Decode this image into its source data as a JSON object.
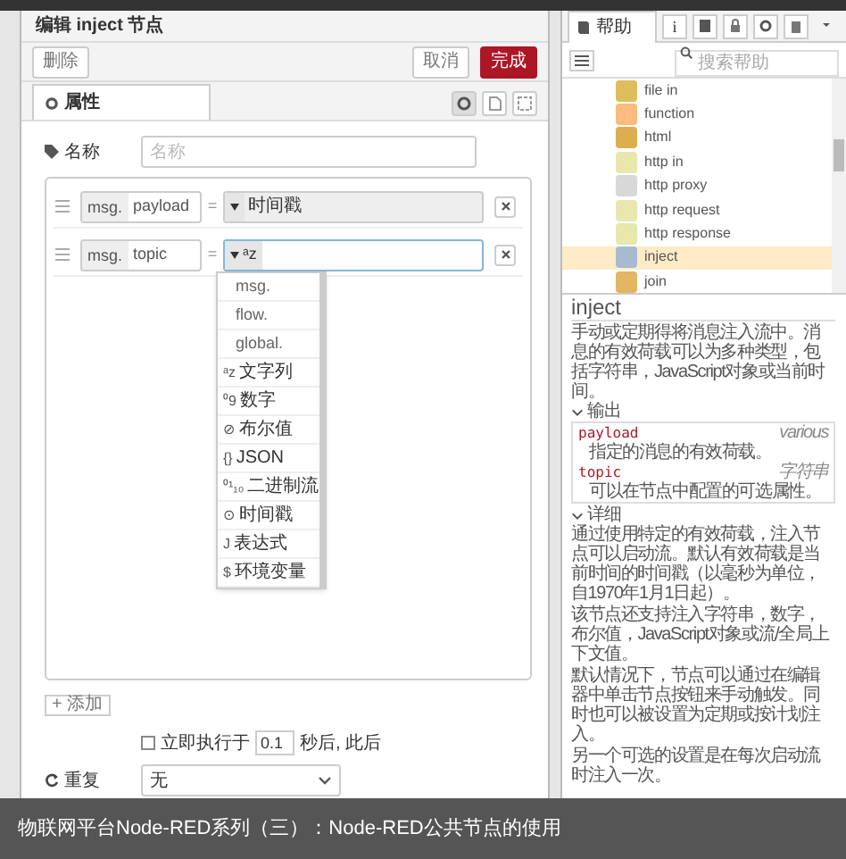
{
  "editor": {
    "title": "编辑 inject 节点",
    "buttons": [
      {
        "label": "删除",
        "kind": "plain"
      },
      {
        "label": "取消",
        "kind": "plain"
      },
      {
        "label": "完成",
        "kind": "primary"
      }
    ],
    "tab": {
      "label": "属性",
      "selected": true
    },
    "name_field": {
      "label": "名称",
      "placeholder": "名称"
    },
    "properties": [
      {
        "prefix": "msg.",
        "field": "payload",
        "equals": "=",
        "value_label": "时间戳",
        "focused": false
      },
      {
        "prefix": "msg.",
        "field": "topic",
        "equals": "=",
        "type_icon": "ᵃz",
        "focused": true
      }
    ],
    "type_menu": [
      {
        "label": "msg."
      },
      {
        "label": "flow."
      },
      {
        "label": "global."
      },
      {
        "icon": "ᵃz",
        "label": "文字列"
      },
      {
        "icon": "⁰9",
        "label": "数字"
      },
      {
        "icon": "⊘",
        "label": "布尔值"
      },
      {
        "icon": "{}",
        "label": "JSON"
      },
      {
        "icon": "⁰¹₁₀",
        "label": "二进制流"
      },
      {
        "icon": "⊙",
        "label": "时间戳"
      },
      {
        "icon": "J",
        "label": "表达式"
      },
      {
        "icon": "$",
        "label": "环境变量"
      }
    ],
    "add_button": "+ 添加",
    "once": {
      "checked": false,
      "label": "立即执行于",
      "value": "0.1",
      "suffix": "秒后, 此后"
    },
    "repeat": {
      "label": "重复",
      "value": "无"
    }
  },
  "sidebar": {
    "tab": {
      "label": "帮助",
      "selected": true
    },
    "tool_icons": [
      "i"
    ],
    "search": {
      "placeholder": "搜索帮助"
    },
    "nodes": [
      {
        "label": "file in",
        "color": "#debd5c",
        "selected": false
      },
      {
        "label": "function",
        "color": "#fdbb7d",
        "selected": false
      },
      {
        "label": "html",
        "color": "#dbae4f",
        "selected": false
      },
      {
        "label": "http in",
        "color": "#e7e7ae",
        "selected": false
      },
      {
        "label": "http proxy",
        "color": "#d8d8d8",
        "selected": false
      },
      {
        "label": "http request",
        "color": "#e7e7ae",
        "selected": false
      },
      {
        "label": "http response",
        "color": "#e7e7ae",
        "selected": false
      },
      {
        "label": "inject",
        "color": "#a6bbcf",
        "selected": true
      },
      {
        "label": "join",
        "color": "#e2b663",
        "selected": false
      }
    ],
    "help": {
      "title": "inject",
      "intro": "手动或定期得将消息注入流中。消息的有效荷载可以为多种类型，包括字符串，JavaScript对象或当前时间。",
      "outputs_heading": "输出",
      "outputs": [
        {
          "name": "payload",
          "type": "various",
          "desc": "指定的消息的有效荷载。"
        },
        {
          "name": "topic",
          "type": "字符串",
          "desc": "可以在节点中配置的可选属性。"
        }
      ],
      "details_heading": "详细",
      "paragraphs": [
        "通过使用特定的有效荷载，注入节点可以启动流。默认有效荷载是当前时间的时间戳（以毫秒为单位，自1970年1月1日起）。",
        "该节点还支持注入字符串，数字，布尔值，JavaScript对象或流/全局上下文值。",
        "默认情况下，节点可以通过在编辑器中单击节点按钮来手动触发。同时也可以被设置为定期或按计划注入。",
        "另一个可选的设置是在每次启动流时注入一次。"
      ]
    }
  },
  "caption": "物联网平台Node-RED系列（三）：Node-RED公共节点的使用"
}
